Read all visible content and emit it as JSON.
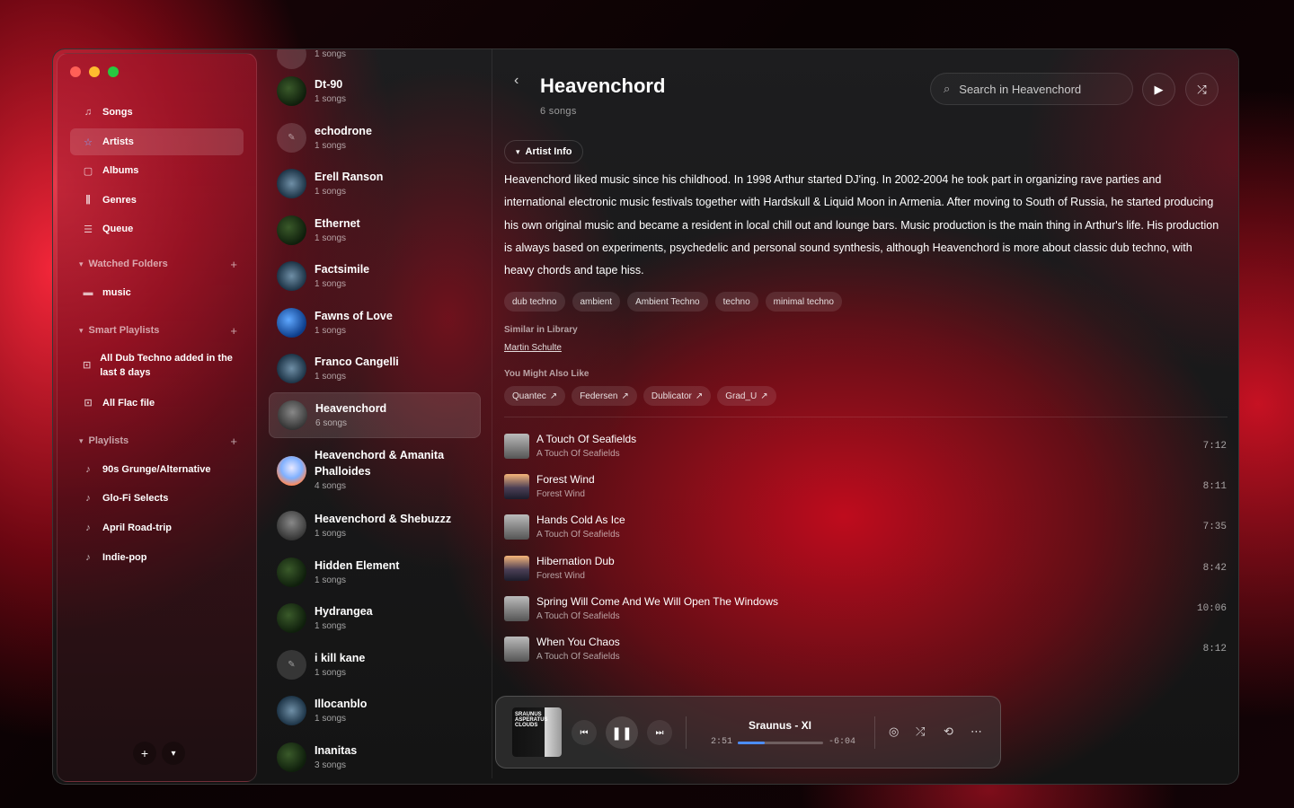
{
  "sidebar": {
    "nav": [
      {
        "label": "Songs",
        "icon": "music-note-list-icon"
      },
      {
        "label": "Artists",
        "icon": "star-icon"
      },
      {
        "label": "Albums",
        "icon": "album-icon"
      },
      {
        "label": "Genres",
        "icon": "genres-icon"
      },
      {
        "label": "Queue",
        "icon": "queue-icon"
      }
    ],
    "watched_folders": {
      "title": "Watched Folders",
      "items": [
        {
          "label": "music"
        }
      ]
    },
    "smart_playlists": {
      "title": "Smart Playlists",
      "items": [
        {
          "label": "All Dub Techno added in the last 8 days"
        },
        {
          "label": "All Flac file"
        }
      ]
    },
    "playlists": {
      "title": "Playlists",
      "items": [
        {
          "label": "90s Grunge/Alternative"
        },
        {
          "label": "Glo-Fi Selects"
        },
        {
          "label": "April Road-trip"
        },
        {
          "label": "Indie-pop"
        }
      ]
    }
  },
  "artists": [
    {
      "name": "",
      "count": "1 songs"
    },
    {
      "name": "Dt-90",
      "count": "1 songs"
    },
    {
      "name": "echodrone",
      "count": "1 songs"
    },
    {
      "name": "Erell Ranson",
      "count": "1 songs"
    },
    {
      "name": "Ethernet",
      "count": "1 songs"
    },
    {
      "name": "Factsimile",
      "count": "1 songs"
    },
    {
      "name": "Fawns of Love",
      "count": "1 songs"
    },
    {
      "name": "Franco Cangelli",
      "count": "1 songs"
    },
    {
      "name": "Heavenchord",
      "count": "6 songs"
    },
    {
      "name": "Heavenchord & Amanita Phalloides",
      "count": "4 songs"
    },
    {
      "name": "Heavenchord & Shebuzzz",
      "count": "1 songs"
    },
    {
      "name": "Hidden Element",
      "count": "1 songs"
    },
    {
      "name": "Hydrangea",
      "count": "1 songs"
    },
    {
      "name": "i kill kane",
      "count": "1 songs"
    },
    {
      "name": "Illocanblo",
      "count": "1 songs"
    },
    {
      "name": "Inanitas",
      "count": "3 songs"
    }
  ],
  "main": {
    "title": "Heavenchord",
    "subtitle": "6 songs",
    "search_placeholder": "Search in Heavenchord",
    "artist_info_label": "Artist Info",
    "bio": "Heavenchord liked music since his childhood. In 1998 Arthur started DJ'ing. In 2002-2004 he took part in organizing rave parties and international electronic music festivals together with Hardskull & Liquid Moon in Armenia. After moving to South of Russia, he started producing his own original music and became a resident in local chill out and lounge bars. Music production is the main thing in Arthur's life. His production is always based on experiments, psychedelic and personal sound synthesis, although Heavenchord is more about classic dub techno, with heavy chords and tape hiss.",
    "tags": [
      "dub techno",
      "ambient",
      "Ambient Techno",
      "techno",
      "minimal techno"
    ],
    "similar_title": "Similar in Library",
    "similar": "Martin Schulte",
    "also_like_title": "You Might Also Like",
    "also_like": [
      "Quantec",
      "Federsen",
      "Dublicator",
      "Grad_U"
    ],
    "tracks": [
      {
        "title": "A Touch Of Seafields",
        "album": "A Touch Of Seafields",
        "duration": "7:12"
      },
      {
        "title": "Forest Wind",
        "album": "Forest Wind",
        "duration": "8:11"
      },
      {
        "title": "Hands Cold As Ice",
        "album": "A Touch Of Seafields",
        "duration": "7:35"
      },
      {
        "title": "Hibernation Dub",
        "album": "Forest Wind",
        "duration": "8:42"
      },
      {
        "title": "Spring Will Come And We Will Open The Windows",
        "album": "A Touch Of Seafields",
        "duration": "10:06"
      },
      {
        "title": "When You Chaos",
        "album": "A Touch Of Seafields",
        "duration": "8:12"
      }
    ]
  },
  "player": {
    "title": "Sraunus - XI",
    "elapsed": "2:51",
    "remaining": "-6:04",
    "progress_fraction": 0.32,
    "cover_text": "SRAUNUS ASPERATUS CLOUDS",
    "accent": "#4c8dff"
  }
}
